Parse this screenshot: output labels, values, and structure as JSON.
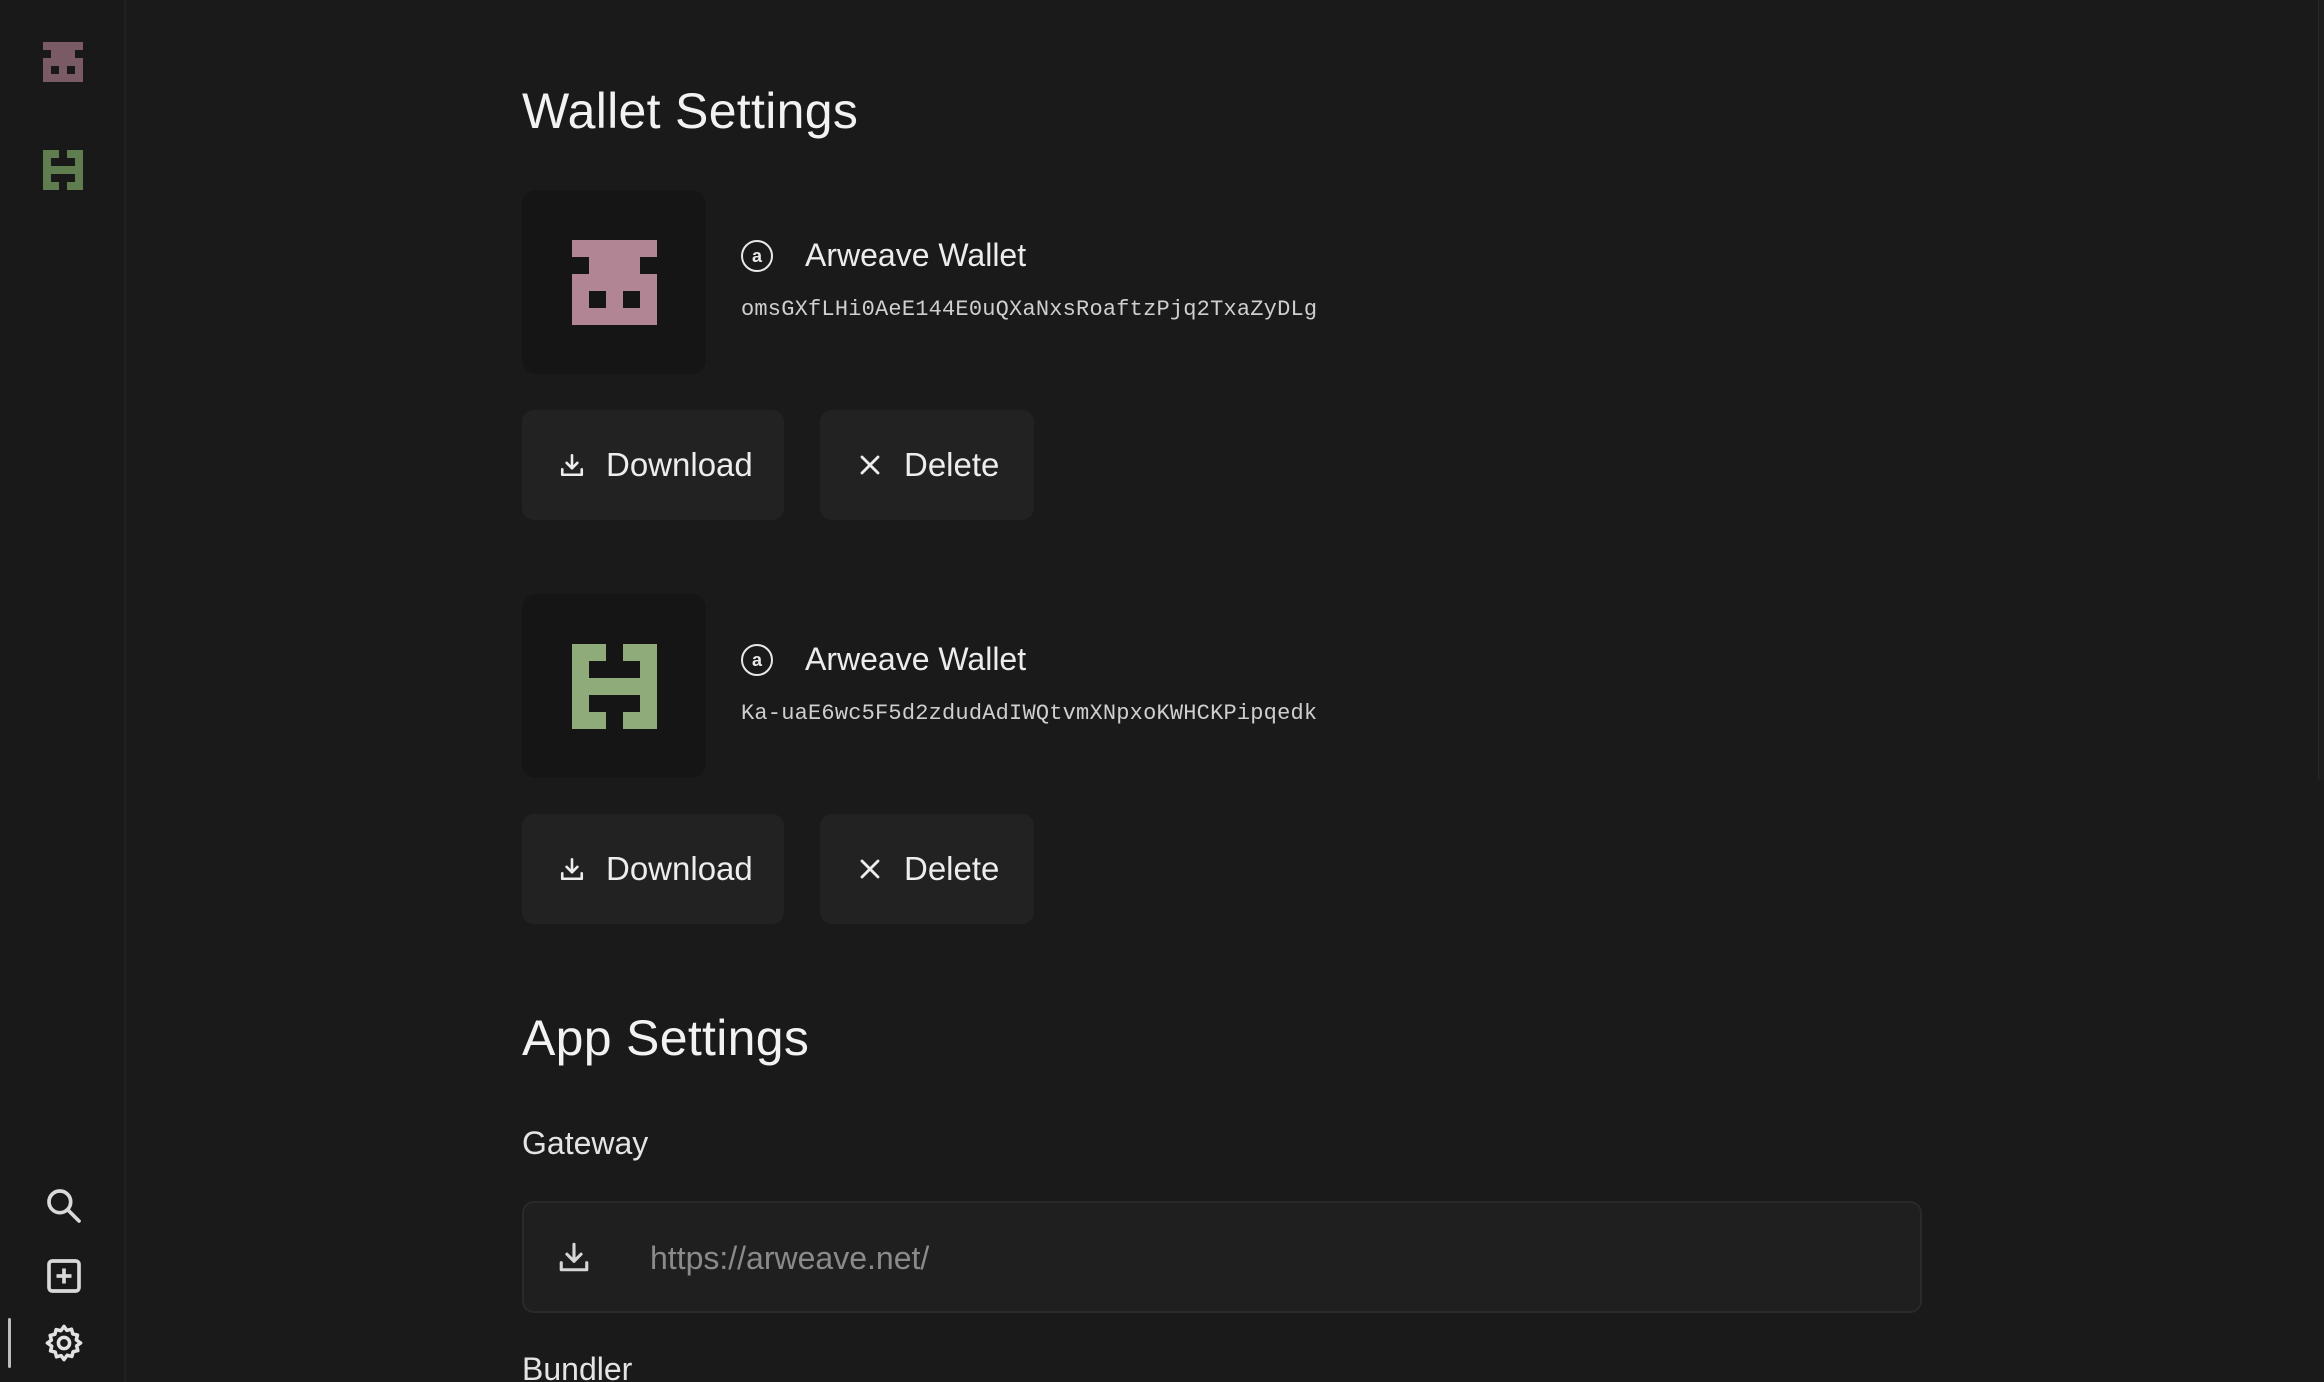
{
  "colors": {
    "background": "#1a1a1a",
    "sidebar": "#191919",
    "button": "#222222",
    "wallet1_avatar": "#b18593",
    "wallet1_avatar_dim": "#7a5b65",
    "wallet2_avatar": "#8fab79",
    "wallet2_avatar_dim": "#5f7d4e"
  },
  "sidebar": {
    "wallet_avatars": [
      {
        "icon": "wallet-identicon-pink-icon"
      },
      {
        "icon": "wallet-identicon-green-icon"
      }
    ],
    "tools": [
      {
        "icon": "search-icon"
      },
      {
        "icon": "add-square-icon"
      },
      {
        "icon": "gear-icon",
        "active": true
      }
    ]
  },
  "wallet_settings": {
    "title": "Wallet Settings",
    "wallets": [
      {
        "badge": "a",
        "name": "Arweave Wallet",
        "address": "omsGXfLHi0AeE144E0uQXaNxsRoaftzPjq2TxaZyDLg",
        "download_label": "Download",
        "delete_label": "Delete"
      },
      {
        "badge": "a",
        "name": "Arweave Wallet",
        "address": "Ka-uaE6wc5F5d2zdudAdIWQtvmXNpxoKWHCKPipqedk",
        "download_label": "Download",
        "delete_label": "Delete"
      }
    ]
  },
  "app_settings": {
    "title": "App Settings",
    "gateway": {
      "label": "Gateway",
      "placeholder": "https://arweave.net/"
    },
    "bundler": {
      "label": "Bundler"
    }
  }
}
